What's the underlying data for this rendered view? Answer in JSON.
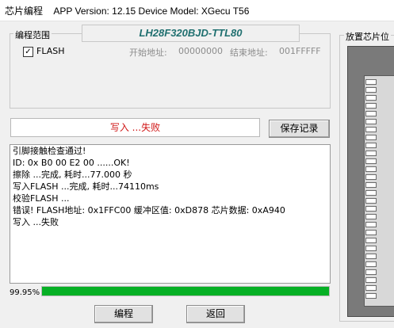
{
  "window": {
    "title_app": "芯片编程",
    "title_info": "APP Version: 12.15 Device Model: XGecu T56"
  },
  "program_range": {
    "label": "编程范围",
    "chip_name": "LH28F320BJD-TTL80",
    "flash_checked": "✓",
    "flash_label": "FLASH",
    "start_label": "开始地址:",
    "start_value": "00000000",
    "end_label": "结束地址:",
    "end_value": "001FFFFF"
  },
  "chip_placement": {
    "label": "放置芯片位"
  },
  "status": {
    "message": "写入 ...失败"
  },
  "buttons": {
    "save_log": "保存记录",
    "program": "编程",
    "back": "返回"
  },
  "log": {
    "lines": [
      "引脚接触检查通过!",
      "ID: 0x B0 00 E2 00 ......OK!",
      "擦除 ...完成, 耗时...77.000 秒",
      "写入FLASH ...完成, 耗时...74110ms",
      "校验FLASH ...",
      "错误! FLASH地址: 0x1FFC00 缓冲区值: 0xD878 芯片数据: 0xA940",
      "写入 ...失败"
    ]
  },
  "progress": {
    "label": "99.95%",
    "value": 0.9995
  },
  "colors": {
    "chip_name": "#1f6f6f",
    "status_error": "#d01818",
    "progress_fill": "#06b025"
  }
}
